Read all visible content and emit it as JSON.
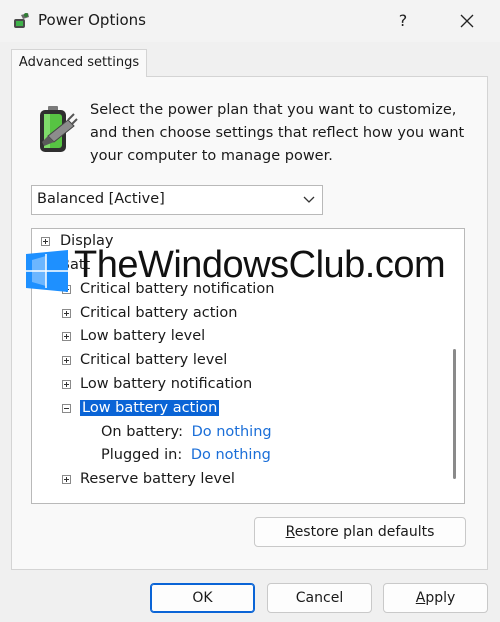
{
  "window": {
    "title": "Power Options",
    "help_label": "?"
  },
  "tab": {
    "label": "Advanced settings"
  },
  "description": {
    "line1": "Select the power plan that you want to customize,",
    "line2": "and then choose settings that reflect how you want",
    "line3": "your computer to manage power."
  },
  "plan_select": {
    "value": "Balanced [Active]"
  },
  "tree": {
    "display": "Display",
    "battery_partial": "Batt",
    "critical_battery_notification": "Critical battery notification",
    "critical_battery_action": "Critical battery action",
    "low_battery_level": "Low battery level",
    "critical_battery_level": "Critical battery level",
    "low_battery_notification": "Low battery notification",
    "low_battery_action": "Low battery action",
    "on_battery_label": "On battery:",
    "on_battery_value": "Do nothing",
    "plugged_in_label": "Plugged in:",
    "plugged_in_value": "Do nothing",
    "reserve_battery_level": "Reserve battery level"
  },
  "watermark": {
    "text": "TheWindowsClub.com"
  },
  "buttons": {
    "restore_first": "R",
    "restore_rest": "estore plan defaults",
    "ok": "OK",
    "cancel": "Cancel",
    "apply_first": "A",
    "apply_rest": "pply"
  },
  "colors": {
    "accent": "#0a64d6",
    "link": "#1a6ed8"
  }
}
